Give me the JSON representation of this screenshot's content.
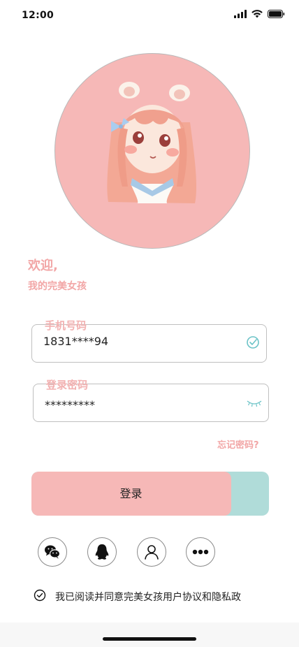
{
  "status_bar": {
    "time": "12:00"
  },
  "welcome": {
    "title": "欢迎,",
    "subtitle": "我的完美女孩"
  },
  "phone_field": {
    "label": "手机号码",
    "value": "1831****94"
  },
  "password_field": {
    "label": "登录密码",
    "value": "*********"
  },
  "forgot_password": "忘记密码?",
  "login_button": {
    "label": "登录",
    "progress": 0.84
  },
  "social_logins": [
    {
      "icon": "wechat-icon"
    },
    {
      "icon": "qq-icon"
    },
    {
      "icon": "user-icon"
    },
    {
      "icon": "more-icon"
    }
  ],
  "agreement": {
    "text": "我已阅读并同意完美女孩用户协议和隐私政",
    "checked": true
  },
  "colors": {
    "pink": "#f6b8b7",
    "pink_text": "#f2a6a6",
    "teal": "#b0dcd9",
    "check_teal": "#6bc3c7"
  }
}
